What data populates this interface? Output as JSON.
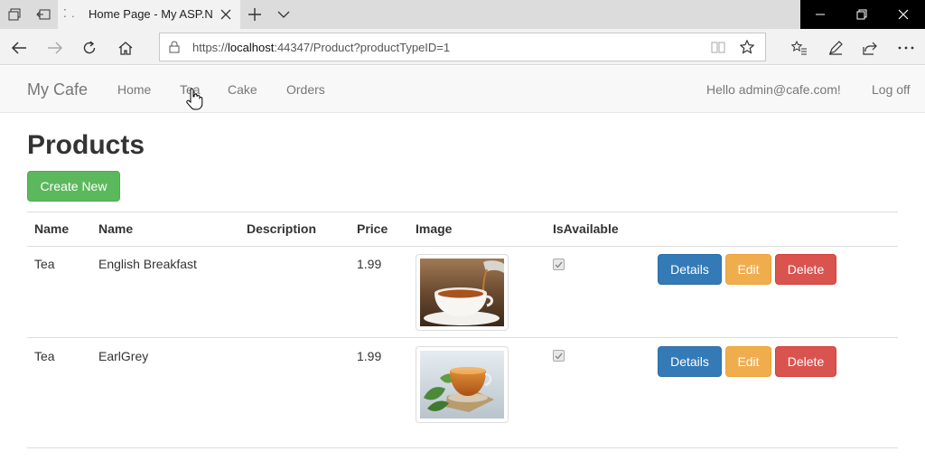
{
  "browser": {
    "tab_title": "Home Page - My ASP.N",
    "url_prefix": "https://",
    "url_host": "localhost",
    "url_rest": ":44347/Product?productTypeID=1"
  },
  "site": {
    "brand": "My Cafe",
    "nav": [
      "Home",
      "Tea",
      "Cake",
      "Orders"
    ],
    "greeting": "Hello admin@cafe.com!",
    "logoff": "Log off"
  },
  "page": {
    "title": "Products",
    "create_label": "Create New"
  },
  "table": {
    "headers": [
      "Name",
      "Name",
      "Description",
      "Price",
      "Image",
      "IsAvailable"
    ],
    "rows": [
      {
        "type": "Tea",
        "name": "English Breakfast",
        "description": "",
        "price": "1.99",
        "image": "tea-cup-pour-photo",
        "available": true,
        "actions": [
          "Details",
          "Edit",
          "Delete"
        ]
      },
      {
        "type": "Tea",
        "name": "EarlGrey",
        "description": "",
        "price": "1.99",
        "image": "tea-glass-cup-photo",
        "available": true,
        "actions": [
          "Details",
          "Edit",
          "Delete"
        ]
      }
    ]
  },
  "colors": {
    "success": "#5cb85c",
    "primary": "#337ab7",
    "warning": "#f0ad4e",
    "danger": "#d9534f"
  }
}
